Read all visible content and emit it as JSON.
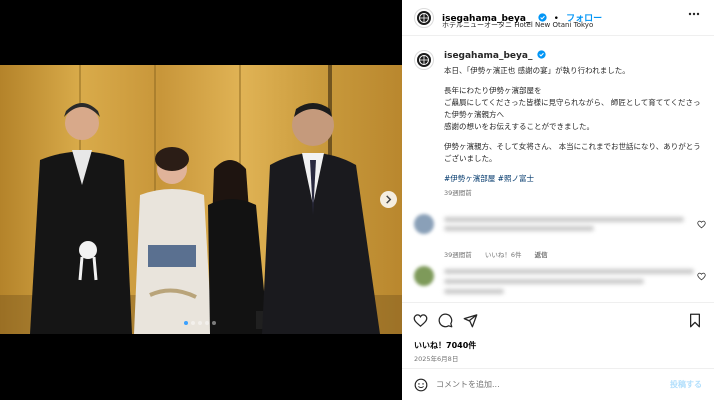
{
  "post": {
    "username": "isegahama_beya_",
    "follow_label": "フォロー",
    "separator": "•",
    "location": "ホテルニューオータニ Hotel New Otani Tokyo",
    "caption": {
      "username": "isegahama_beya_",
      "lines": [
        "本日、「伊勢ヶ濱正也 感謝の宴」が執り行われました。",
        "長年にわたり伊勢ヶ濱部屋を\nご贔屓にしてくださった皆様に見守られながら、 師匠として育ててくださった伊勢ヶ濱親方へ\n感謝の想いをお伝えすることができました。",
        "伊勢ヶ濱親方、そして女将さん、 本当にこれまでお世話になり、ありがとうございました。"
      ],
      "hashtags": "#伊勢ヶ濱部屋 #照ノ富士",
      "time": "39週間前"
    },
    "comments": [
      {
        "time": "39週間前",
        "likes": "いいね！6件",
        "reply": "返信"
      },
      {
        "time": "",
        "likes": "",
        "reply": ""
      }
    ],
    "likes_count": "いいね！7040件",
    "date": "2025年6月8日",
    "add_comment_placeholder": "コメントを追加...",
    "post_button": "投稿する"
  },
  "colors": {
    "link_blue": "#0095f6",
    "hashtag": "#00376b",
    "gold_wall": "#c89a3a",
    "muted": "#737373"
  },
  "icons": [
    "logo-icon",
    "verified-icon",
    "more-icon",
    "heart-icon",
    "comment-icon",
    "share-icon",
    "bookmark-icon",
    "emoji-icon",
    "chevron-right-icon"
  ]
}
